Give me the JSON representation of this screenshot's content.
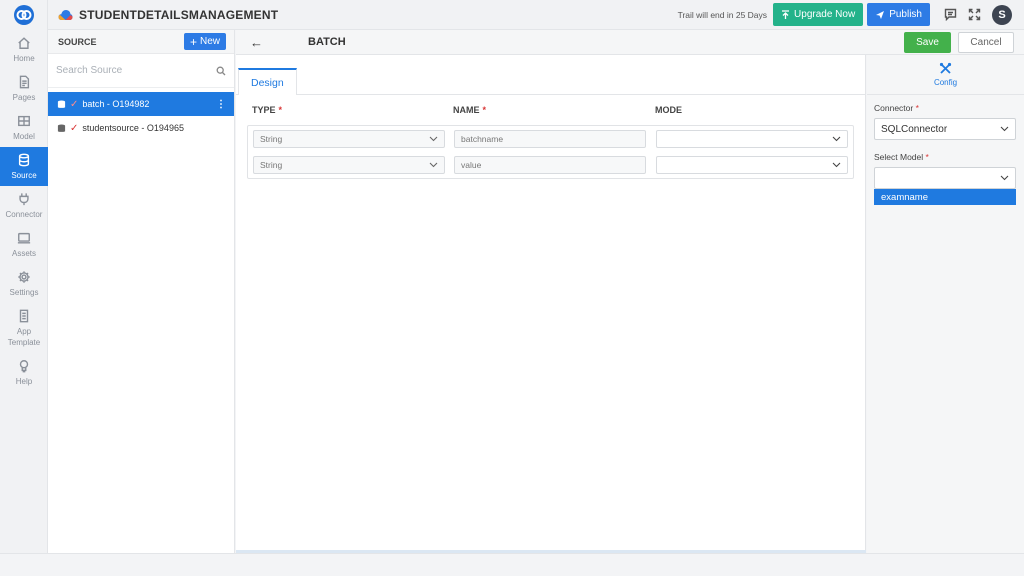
{
  "header": {
    "app_name": "STUDENTDETAILSMANAGEMENT",
    "trail_text": "Trail will end in 25 Days",
    "upgrade_label": "Upgrade Now",
    "publish_label": "Publish",
    "avatar_initial": "S"
  },
  "nav": {
    "items": [
      {
        "label": "Home",
        "icon": "home-icon"
      },
      {
        "label": "Pages",
        "icon": "pages-icon"
      },
      {
        "label": "Model",
        "icon": "model-icon"
      },
      {
        "label": "Source",
        "icon": "database-icon",
        "active": true
      },
      {
        "label": "Connector",
        "icon": "plug-icon"
      },
      {
        "label": "Assets",
        "icon": "assets-icon"
      },
      {
        "label": "Settings",
        "icon": "gear-icon"
      },
      {
        "label": "App Template",
        "icon": "template-icon"
      },
      {
        "label": "Help",
        "icon": "help-icon"
      }
    ]
  },
  "source_panel": {
    "title": "SOURCE",
    "new_label": "New",
    "search_placeholder": "Search Source",
    "items": [
      {
        "label": "batch - O194982",
        "selected": true
      },
      {
        "label": "studentsource - O194965",
        "selected": false
      }
    ]
  },
  "main": {
    "back_label": "←",
    "title": "BATCH",
    "save_label": "Save",
    "cancel_label": "Cancel",
    "tabs": [
      {
        "label": "Design"
      }
    ],
    "columns": {
      "type": "TYPE",
      "name": "NAME",
      "mode": "MODE",
      "required_mark": "*"
    },
    "rows": [
      {
        "type": "String",
        "name": "batchname",
        "mode": ""
      },
      {
        "type": "String",
        "name": "value",
        "mode": ""
      }
    ]
  },
  "config": {
    "tab_label": "Config",
    "connector_label": "Connector",
    "connector_value": "SQLConnector",
    "model_label": "Select Model",
    "model_value": "",
    "required_mark": "*",
    "options": [
      "examname"
    ]
  },
  "colors": {
    "accent": "#1f7ae0",
    "upgrade": "#23b28a",
    "save": "#43b14b",
    "required": "#d93636"
  }
}
